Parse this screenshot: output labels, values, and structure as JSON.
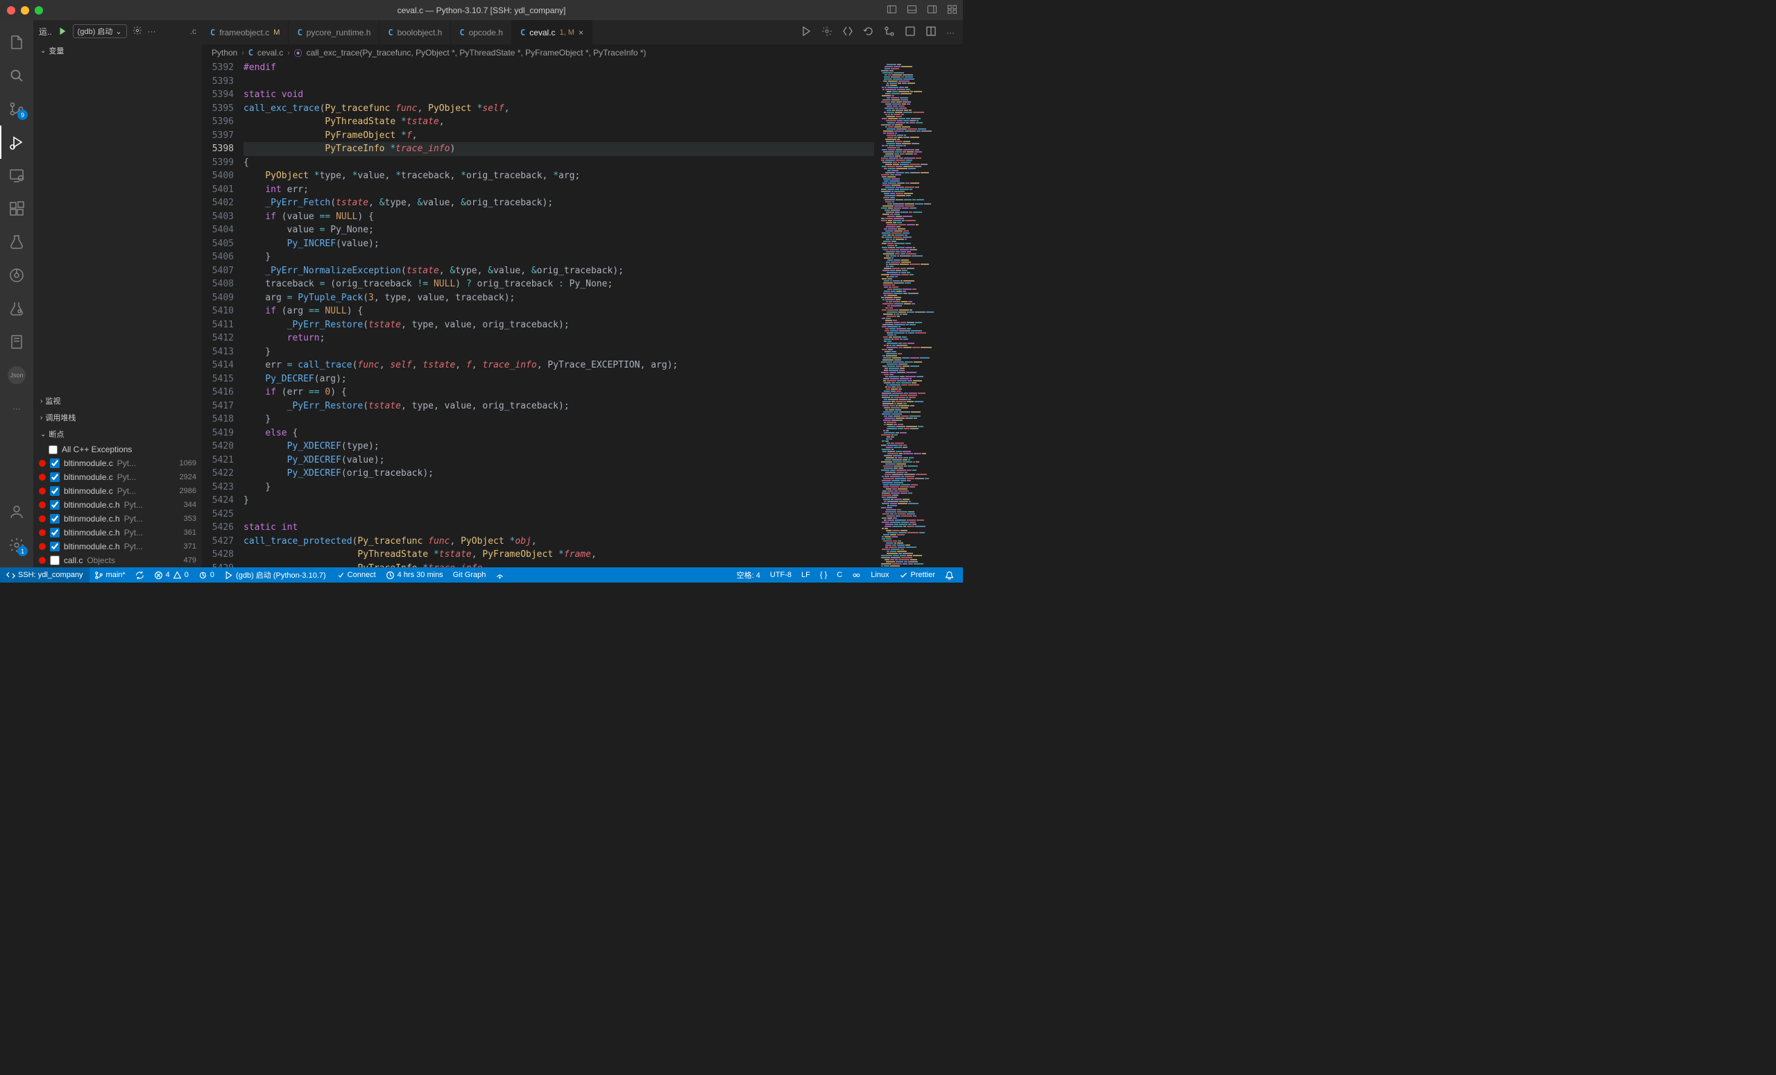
{
  "window_title": "ceval.c — Python-3.10.7 [SSH: ydl_company]",
  "sidebar_top": {
    "run_label": "运..",
    "launch": "(gdb) 启动",
    "file_badge": ".c"
  },
  "sections": {
    "variables": "变量",
    "watch": "监视",
    "callstack": "调用堆栈",
    "breakpoints": "断点"
  },
  "all_exceptions": "All C++ Exceptions",
  "breakpoints": [
    {
      "file": "bltinmodule.c",
      "path": "Pyt...",
      "line": "1069"
    },
    {
      "file": "bltinmodule.c",
      "path": "Pyt...",
      "line": "2924"
    },
    {
      "file": "bltinmodule.c",
      "path": "Pyt...",
      "line": "2986"
    },
    {
      "file": "bltinmodule.c.h",
      "path": "Pyt...",
      "line": "344"
    },
    {
      "file": "bltinmodule.c.h",
      "path": "Pyt...",
      "line": "353"
    },
    {
      "file": "bltinmodule.c.h",
      "path": "Pyt...",
      "line": "361"
    },
    {
      "file": "bltinmodule.c.h",
      "path": "Pyt...",
      "line": "371"
    },
    {
      "file": "call.c",
      "path": "Objects",
      "line": "479"
    }
  ],
  "tabs": [
    {
      "name": "frameobject.c",
      "mod": "M",
      "active": false
    },
    {
      "name": "pycore_runtime.h",
      "mod": "",
      "active": false
    },
    {
      "name": "boolobject.h",
      "mod": "",
      "active": false
    },
    {
      "name": "opcode.h",
      "mod": "",
      "active": false
    },
    {
      "name": "ceval.c",
      "mod": "1, M",
      "active": true
    }
  ],
  "breadcrumb": {
    "p0": "Python",
    "p1": "ceval.c",
    "p2": "call_exc_trace(Py_tracefunc, PyObject *, PyThreadState *, PyFrameObject *, PyTraceInfo *)"
  },
  "source_control_badge": "9",
  "gear_badge": "1",
  "line_start": 5392,
  "current_line": 5398,
  "code_lines": [
    "<span class='pp'>#endif</span>",
    "",
    "<span class='kw'>static</span> <span class='ty'>void</span>",
    "<span class='fn'>call_exc_trace</span><span class='pun'>(</span><span class='tyn'>Py_tracefunc</span> <span class='var'>func</span><span class='pun'>,</span> <span class='tyn'>PyObject</span> <span class='op'>*</span><span class='var'>self</span><span class='pun'>,</span>",
    "               <span class='tyn'>PyThreadState</span> <span class='op'>*</span><span class='var'>tstate</span><span class='pun'>,</span>",
    "               <span class='tyn'>PyFrameObject</span> <span class='op'>*</span><span class='var'>f</span><span class='pun'>,</span>",
    "               <span class='tyn'>PyTraceInfo</span> <span class='op'>*</span><span class='var'>trace_info</span><span class='pun'>)</span>",
    "<span class='pun'>{</span>",
    "    <span class='tyn'>PyObject</span> <span class='op'>*</span><span class='id'>type</span><span class='pun'>,</span> <span class='op'>*</span><span class='id'>value</span><span class='pun'>,</span> <span class='op'>*</span><span class='id'>traceback</span><span class='pun'>,</span> <span class='op'>*</span><span class='id'>orig_traceback</span><span class='pun'>,</span> <span class='op'>*</span><span class='id'>arg</span><span class='pun'>;</span>",
    "    <span class='ty'>int</span> <span class='id'>err</span><span class='pun'>;</span>",
    "    <span class='fn'>_PyErr_Fetch</span><span class='pun'>(</span><span class='var'>tstate</span><span class='pun'>,</span> <span class='op'>&amp;</span><span class='id'>type</span><span class='pun'>,</span> <span class='op'>&amp;</span><span class='id'>value</span><span class='pun'>,</span> <span class='op'>&amp;</span><span class='id'>orig_traceback</span><span class='pun'>);</span>",
    "    <span class='kw'>if</span> <span class='pun'>(</span><span class='id'>value</span> <span class='op'>==</span> <span class='con'>NULL</span><span class='pun'>) {</span>",
    "        <span class='id'>value</span> <span class='op'>=</span> <span class='id'>Py_None</span><span class='pun'>;</span>",
    "        <span class='fn'>Py_INCREF</span><span class='pun'>(</span><span class='id'>value</span><span class='pun'>);</span>",
    "    <span class='pun'>}</span>",
    "    <span class='fn'>_PyErr_NormalizeException</span><span class='pun'>(</span><span class='var'>tstate</span><span class='pun'>,</span> <span class='op'>&amp;</span><span class='id'>type</span><span class='pun'>,</span> <span class='op'>&amp;</span><span class='id'>value</span><span class='pun'>,</span> <span class='op'>&amp;</span><span class='id'>orig_traceback</span><span class='pun'>);</span>",
    "    <span class='id'>traceback</span> <span class='op'>=</span> <span class='pun'>(</span><span class='id'>orig_traceback</span> <span class='op'>!=</span> <span class='con'>NULL</span><span class='pun'>)</span> <span class='op'>?</span> <span class='id'>orig_traceback</span> <span class='op'>:</span> <span class='id'>Py_None</span><span class='pun'>;</span>",
    "    <span class='id'>arg</span> <span class='op'>=</span> <span class='fn'>PyTuple_Pack</span><span class='pun'>(</span><span class='num'>3</span><span class='pun'>,</span> <span class='id'>type</span><span class='pun'>,</span> <span class='id'>value</span><span class='pun'>,</span> <span class='id'>traceback</span><span class='pun'>);</span>",
    "    <span class='kw'>if</span> <span class='pun'>(</span><span class='id'>arg</span> <span class='op'>==</span> <span class='con'>NULL</span><span class='pun'>) {</span>",
    "        <span class='fn'>_PyErr_Restore</span><span class='pun'>(</span><span class='var'>tstate</span><span class='pun'>,</span> <span class='id'>type</span><span class='pun'>,</span> <span class='id'>value</span><span class='pun'>,</span> <span class='id'>orig_traceback</span><span class='pun'>);</span>",
    "        <span class='kw'>return</span><span class='pun'>;</span>",
    "    <span class='pun'>}</span>",
    "    <span class='id'>err</span> <span class='op'>=</span> <span class='fn'>call_trace</span><span class='pun'>(</span><span class='var'>func</span><span class='pun'>,</span> <span class='var'>self</span><span class='pun'>,</span> <span class='var'>tstate</span><span class='pun'>,</span> <span class='var'>f</span><span class='pun'>,</span> <span class='var'>trace_info</span><span class='pun'>,</span> <span class='id'>PyTrace_EXCEPTION</span><span class='pun'>,</span> <span class='id'>arg</span><span class='pun'>);</span>",
    "    <span class='fn'>Py_DECREF</span><span class='pun'>(</span><span class='id'>arg</span><span class='pun'>);</span>",
    "    <span class='kw'>if</span> <span class='pun'>(</span><span class='id'>err</span> <span class='op'>==</span> <span class='num'>0</span><span class='pun'>) {</span>",
    "        <span class='fn'>_PyErr_Restore</span><span class='pun'>(</span><span class='var'>tstate</span><span class='pun'>,</span> <span class='id'>type</span><span class='pun'>,</span> <span class='id'>value</span><span class='pun'>,</span> <span class='id'>orig_traceback</span><span class='pun'>);</span>",
    "    <span class='pun'>}</span>",
    "    <span class='kw'>else</span> <span class='pun'>{</span>",
    "        <span class='fn'>Py_XDECREF</span><span class='pun'>(</span><span class='id'>type</span><span class='pun'>);</span>",
    "        <span class='fn'>Py_XDECREF</span><span class='pun'>(</span><span class='id'>value</span><span class='pun'>);</span>",
    "        <span class='fn'>Py_XDECREF</span><span class='pun'>(</span><span class='id'>orig_traceback</span><span class='pun'>);</span>",
    "    <span class='pun'>}</span>",
    "<span class='pun'>}</span>",
    "",
    "<span class='kw'>static</span> <span class='ty'>int</span>",
    "<span class='fn'>call_trace_protected</span><span class='pun'>(</span><span class='tyn'>Py_tracefunc</span> <span class='var'>func</span><span class='pun'>,</span> <span class='tyn'>PyObject</span> <span class='op'>*</span><span class='var'>obj</span><span class='pun'>,</span>",
    "                     <span class='tyn'>PyThreadState</span> <span class='op'>*</span><span class='var'>tstate</span><span class='pun'>,</span> <span class='tyn'>PyFrameObject</span> <span class='op'>*</span><span class='var'>frame</span><span class='pun'>,</span>",
    "                     <span class='tyn'>PyTraceInfo</span> <span class='op'>*</span><span class='var'>trace_info</span><span class='pun'>,</span>"
  ],
  "statusbar": {
    "remote": "SSH: ydl_company",
    "branch": "main*",
    "errors": "4",
    "warnings": "0",
    "port": "0",
    "debug": "(gdb) 启动 (Python-3.10.7)",
    "connect": "Connect",
    "clock": "4 hrs 30 mins",
    "gitgraph": "Git Graph",
    "spaces": "空格: 4",
    "encoding": "UTF-8",
    "eol": "LF",
    "lang": "C",
    "os": "Linux",
    "prettier": "Prettier"
  }
}
